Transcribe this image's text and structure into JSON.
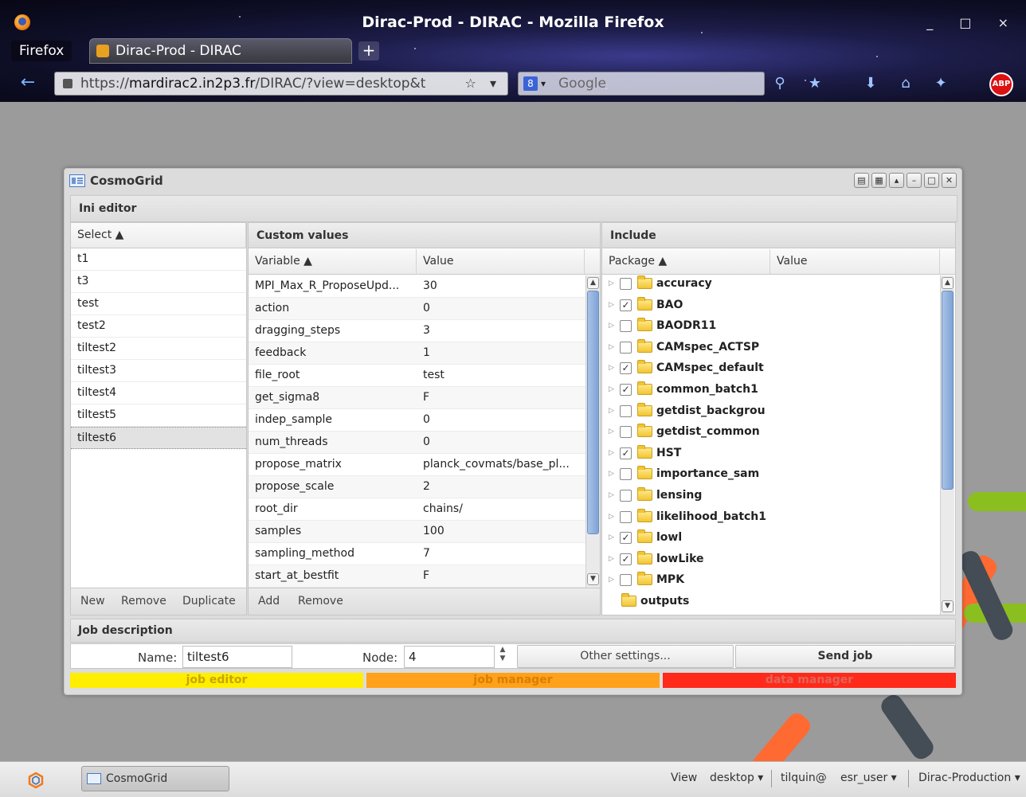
{
  "browser": {
    "window_title": "Dirac-Prod - DIRAC - Mozilla Firefox",
    "window_controls": "_ □ ×",
    "menu_button": "Firefox",
    "tab_title": "Dirac-Prod - DIRAC",
    "new_tab": "+",
    "url_prefix": "https://",
    "url_host": "mardirac2.in2p3.fr",
    "url_path": "/DIRAC/?view=desktop&t",
    "url_end": "☆ ▾",
    "search_engine": "8",
    "search_placeholder": "Google",
    "back": "←",
    "abp": "ABP"
  },
  "window": {
    "title": "CosmoGrid",
    "tools": [
      "▤",
      "▦",
      "▴",
      "–",
      "□",
      "✕"
    ],
    "section_title": "Ini editor"
  },
  "select_panel": {
    "column": "Select ▲",
    "items": [
      "t1",
      "t3",
      "test",
      "test2",
      "tiltest2",
      "tiltest3",
      "tiltest4",
      "tiltest5",
      "tiltest6"
    ],
    "selected_index": 8,
    "buttons": {
      "new": "New",
      "remove": "Remove",
      "duplicate": "Duplicate"
    }
  },
  "custom_panel": {
    "title": "Custom values",
    "col_variable": "Variable ▲",
    "col_value": "Value",
    "rows": [
      {
        "variable": "MPI_Max_R_ProposeUpd...",
        "value": "30"
      },
      {
        "variable": "action",
        "value": "0"
      },
      {
        "variable": "dragging_steps",
        "value": "3"
      },
      {
        "variable": "feedback",
        "value": "1"
      },
      {
        "variable": "file_root",
        "value": "test"
      },
      {
        "variable": "get_sigma8",
        "value": "F"
      },
      {
        "variable": "indep_sample",
        "value": "0"
      },
      {
        "variable": "num_threads",
        "value": "0"
      },
      {
        "variable": "propose_matrix",
        "value": "planck_covmats/base_pl..."
      },
      {
        "variable": "propose_scale",
        "value": "2"
      },
      {
        "variable": "root_dir",
        "value": "chains/"
      },
      {
        "variable": "samples",
        "value": "100"
      },
      {
        "variable": "sampling_method",
        "value": "7"
      },
      {
        "variable": "start_at_bestfit",
        "value": "F"
      }
    ],
    "buttons": {
      "add": "Add",
      "remove": "Remove"
    }
  },
  "include_panel": {
    "title": "Include",
    "col_package": "Package ▲",
    "col_value": "Value",
    "expander": "▷",
    "check_mark": "✓",
    "items": [
      {
        "name": "accuracy",
        "checked": false,
        "expandable": true
      },
      {
        "name": "BAO",
        "checked": true,
        "expandable": true
      },
      {
        "name": "BAODR11",
        "checked": false,
        "expandable": true
      },
      {
        "name": "CAMspec_ACTSP",
        "checked": false,
        "expandable": true
      },
      {
        "name": "CAMspec_default",
        "checked": true,
        "expandable": true
      },
      {
        "name": "common_batch1",
        "checked": true,
        "expandable": true
      },
      {
        "name": "getdist_backgrou",
        "checked": false,
        "expandable": true
      },
      {
        "name": "getdist_common",
        "checked": false,
        "expandable": true
      },
      {
        "name": "HST",
        "checked": true,
        "expandable": true
      },
      {
        "name": "importance_sam",
        "checked": false,
        "expandable": true
      },
      {
        "name": "lensing",
        "checked": false,
        "expandable": true
      },
      {
        "name": "likelihood_batch1",
        "checked": false,
        "expandable": true
      },
      {
        "name": "lowl",
        "checked": true,
        "expandable": true
      },
      {
        "name": "lowLike",
        "checked": true,
        "expandable": true
      },
      {
        "name": "MPK",
        "checked": false,
        "expandable": true
      },
      {
        "name": "outputs",
        "checked": null,
        "expandable": false
      }
    ]
  },
  "job_description": {
    "title": "Job description",
    "name_label": "Name:",
    "name_value": "tiltest6",
    "node_label": "Node:",
    "node_value": "4",
    "other_settings": "Other settings...",
    "send_job": "Send job"
  },
  "status_bars": [
    {
      "label": "job editor",
      "color": "#ffee00",
      "text_color": "#c9a400"
    },
    {
      "label": "job manager",
      "color": "#ffa11a",
      "text_color": "#d97e00"
    },
    {
      "label": "data manager",
      "color": "#ff2a1a",
      "text_color": "#e0655a"
    }
  ],
  "taskbar": {
    "task": "CosmoGrid",
    "view": "View",
    "desktop": "desktop ▾",
    "user": "tilquin@",
    "group": "esr_user ▾",
    "setup": "Dirac-Production ▾"
  },
  "colors": {
    "accent_blue": "#7ea3d6",
    "selected_row": "#e2e2e2"
  }
}
